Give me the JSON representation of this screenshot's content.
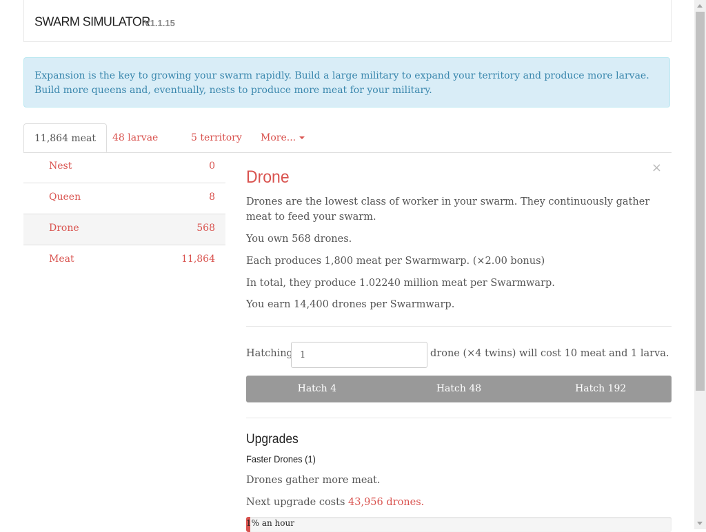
{
  "header": {
    "brand": "SWARM SIMULATOR",
    "version": "V1.1.15"
  },
  "alert": {
    "text": "Expansion is the key to growing your swarm rapidly. Build a large military to expand your territory and produce more larvae. Build more queens and, eventually, nests to produce more meat for your military."
  },
  "tabs": [
    {
      "label": "11,864 meat",
      "active": true
    },
    {
      "label": "48 larvae"
    },
    {
      "label": "5 territory"
    },
    {
      "label": "More..."
    }
  ],
  "units": [
    {
      "name": "Nest",
      "count": "0"
    },
    {
      "name": "Queen",
      "count": "8"
    },
    {
      "name": "Drone",
      "count": "568",
      "selected": true
    },
    {
      "name": "Meat",
      "count": "11,864"
    }
  ],
  "detail": {
    "close": "×",
    "title": "Drone",
    "description": "Drones are the lowest class of worker in your swarm. They continuously gather meat to feed your swarm.",
    "own": "You own 568 drones.",
    "each": "Each produces 1,800 meat per Swarmwarp. (×2.00 bonus)",
    "total": "In total, they produce 1.02240 million meat per Swarmwarp.",
    "earn": "You earn 14,400 drones per Swarmwarp.",
    "hatch_label": "Hatching",
    "hatch_value": "1",
    "hatch_cost": "drone (×4 twins) will cost 10 meat and 1 larva.",
    "buttons": [
      "Hatch 4",
      "Hatch 48",
      "Hatch 192"
    ]
  },
  "upgrades": {
    "title": "Upgrades",
    "name": "Faster Drones (1)",
    "description": "Drones gather more meat.",
    "cost_prefix": "Next upgrade costs",
    "cost_value": "43,956 drones.",
    "progress_text": "1% an hour",
    "progress_fraction": 0.01
  },
  "colors": {
    "accent": "#d9534f",
    "alert_bg": "#d9edf7",
    "alert_text": "#3a87ad",
    "button_bg": "#999999"
  }
}
